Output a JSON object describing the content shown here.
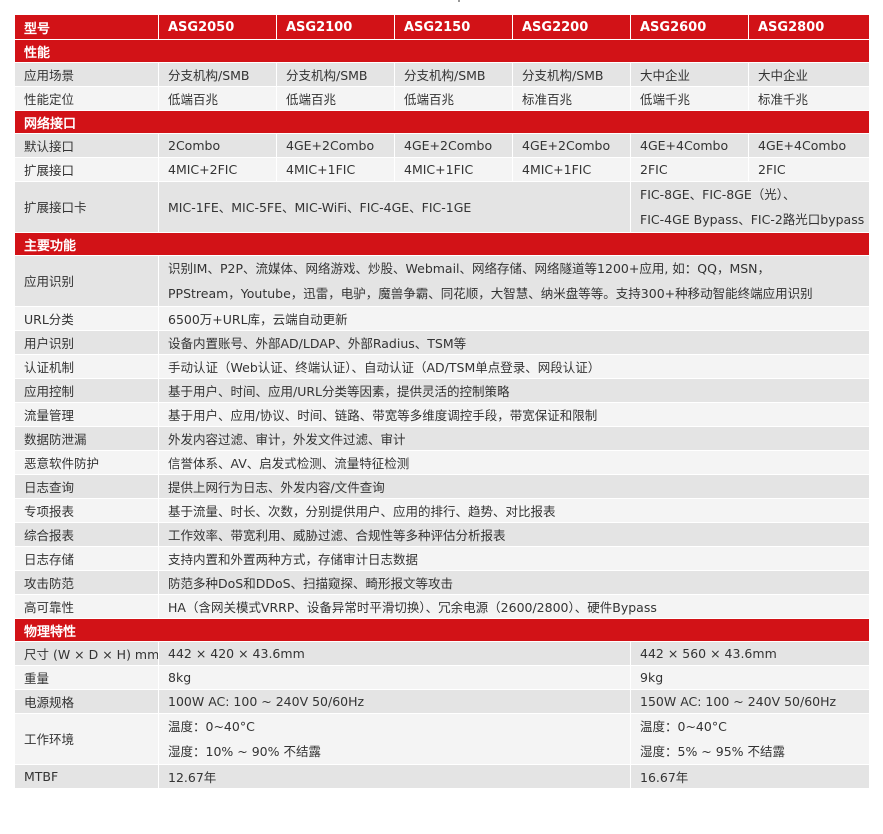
{
  "header": {
    "label": "型号",
    "models": [
      "ASG2050",
      "ASG2100",
      "ASG2150",
      "ASG2200",
      "ASG2600",
      "ASG2800"
    ]
  },
  "sections": {
    "performance": "性能",
    "network": "网络接口",
    "functions": "主要功能",
    "physical": "物理特性"
  },
  "performance": {
    "scenario": {
      "label": "应用场景",
      "values": [
        "分支机构/SMB",
        "分支机构/SMB",
        "分支机构/SMB",
        "分支机构/SMB",
        "大中企业",
        "大中企业"
      ]
    },
    "positioning": {
      "label": "性能定位",
      "values": [
        "低端百兆",
        "低端百兆",
        "低端百兆",
        "标准百兆",
        "低端千兆",
        "标准千兆"
      ]
    }
  },
  "network": {
    "default_ports": {
      "label": "默认接口",
      "values": [
        "2Combo",
        "4GE+2Combo",
        "4GE+2Combo",
        "4GE+2Combo",
        "4GE+4Combo",
        "4GE+4Combo"
      ]
    },
    "expansion_ports": {
      "label": "扩展接口",
      "values": [
        "4MIC+2FIC",
        "4MIC+1FIC",
        "4MIC+1FIC",
        "4MIC+1FIC",
        "2FIC",
        "2FIC"
      ]
    },
    "expansion_cards": {
      "label": "扩展接口卡",
      "low": "MIC-1FE、MIC-5FE、MIC-WiFi、FIC-4GE、FIC-1GE",
      "high_line1": "FIC-8GE、FIC-8GE（光）、",
      "high_line2": "FIC-4GE Bypass、FIC-2路光口bypass"
    }
  },
  "functions": {
    "app_id": {
      "label": "应用识别",
      "line1": "识别IM、P2P、流媒体、网络游戏、炒股、Webmail、网络存储、网络隧道等1200+应用, 如：QQ，MSN，",
      "line2": "PPStream，Youtube，迅雷，电驴，魔兽争霸、同花顺，大智慧、纳米盘等等。支持300+种移动智能终端应用识别"
    },
    "rows": [
      {
        "label": "URL分类",
        "value": "6500万+URL库，云端自动更新"
      },
      {
        "label": "用户识别",
        "value": "设备内置账号、外部AD/LDAP、外部Radius、TSM等"
      },
      {
        "label": "认证机制",
        "value": "手动认证（Web认证、终端认证）、自动认证（AD/TSM单点登录、网段认证）"
      },
      {
        "label": "应用控制",
        "value": "基于用户、时间、应用/URL分类等因素，提供灵活的控制策略"
      },
      {
        "label": "流量管理",
        "value": "基于用户、应用/协议、时间、链路、带宽等多维度调控手段，带宽保证和限制"
      },
      {
        "label": "数据防泄漏",
        "value": "外发内容过滤、审计，外发文件过滤、审计"
      },
      {
        "label": "恶意软件防护",
        "value": "信誉体系、AV、启发式检测、流量特征检测"
      },
      {
        "label": "日志查询",
        "value": "提供上网行为日志、外发内容/文件查询"
      },
      {
        "label": "专项报表",
        "value": "基于流量、时长、次数，分别提供用户、应用的排行、趋势、对比报表"
      },
      {
        "label": "综合报表",
        "value": "工作效率、带宽利用、威胁过滤、合规性等多种评估分析报表"
      },
      {
        "label": "日志存储",
        "value": "支持内置和外置两种方式，存储审计日志数据"
      },
      {
        "label": "攻击防范",
        "value": "防范多种DoS和DDoS、扫描窥探、畸形报文等攻击"
      },
      {
        "label": "高可靠性",
        "value": "HA（含网关模式VRRP、设备异常时平滑切换）、冗余电源（2600/2800）、硬件Bypass"
      }
    ]
  },
  "physical": {
    "size": {
      "label": "尺寸 (W × D × H) mm",
      "low": "442 × 420 × 43.6mm",
      "high": "442 × 560 × 43.6mm"
    },
    "weight": {
      "label": "重量",
      "low": "8kg",
      "high": "9kg"
    },
    "power": {
      "label": "电源规格",
      "low": "100W AC: 100 ~ 240V 50/60Hz",
      "high": "150W AC: 100 ~ 240V 50/60Hz"
    },
    "environment": {
      "label": "工作环境",
      "low_line1": "温度：0~40°C",
      "low_line2": "湿度：10% ~ 90%  不结露",
      "high_line1": "温度：0~40°C",
      "high_line2": "湿度：5% ~ 95%  不结露"
    },
    "mtbf": {
      "label": "MTBF",
      "low": "12.67年",
      "high": "16.67年"
    }
  },
  "colors": {
    "accent": "#d21217",
    "row_dark": "#e4e4e4",
    "row_light": "#f4f4f4"
  }
}
